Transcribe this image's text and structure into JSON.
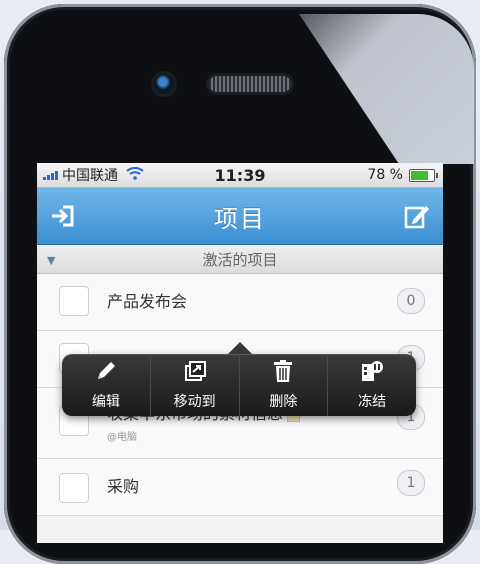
{
  "status": {
    "carrier": "中国联通",
    "time": "11:39",
    "battery_pct": "78 %",
    "battery_level": 0.78
  },
  "nav": {
    "title": "项目",
    "left_icon": "logout-icon",
    "right_icon": "edit-icon"
  },
  "section": {
    "title": "激活的项目"
  },
  "rows": [
    {
      "title": "产品发布会",
      "count": "0",
      "sub": ""
    },
    {
      "title": "",
      "count": "1",
      "sub": ""
    },
    {
      "title": "收集华东市场的素材信息",
      "count": "1",
      "sub": "@电脑"
    },
    {
      "title": "采购",
      "count": "1",
      "sub": ""
    }
  ],
  "popup": {
    "actions": [
      {
        "label": "编辑",
        "icon": "pencil-icon"
      },
      {
        "label": "移动到",
        "icon": "move-icon"
      },
      {
        "label": "删除",
        "icon": "trash-icon"
      },
      {
        "label": "冻结",
        "icon": "freeze-icon"
      }
    ]
  },
  "colors": {
    "nav_blue": "#3c8fd2",
    "status_signal": "#2a6ad0",
    "battery_green": "#3cbf2e"
  }
}
